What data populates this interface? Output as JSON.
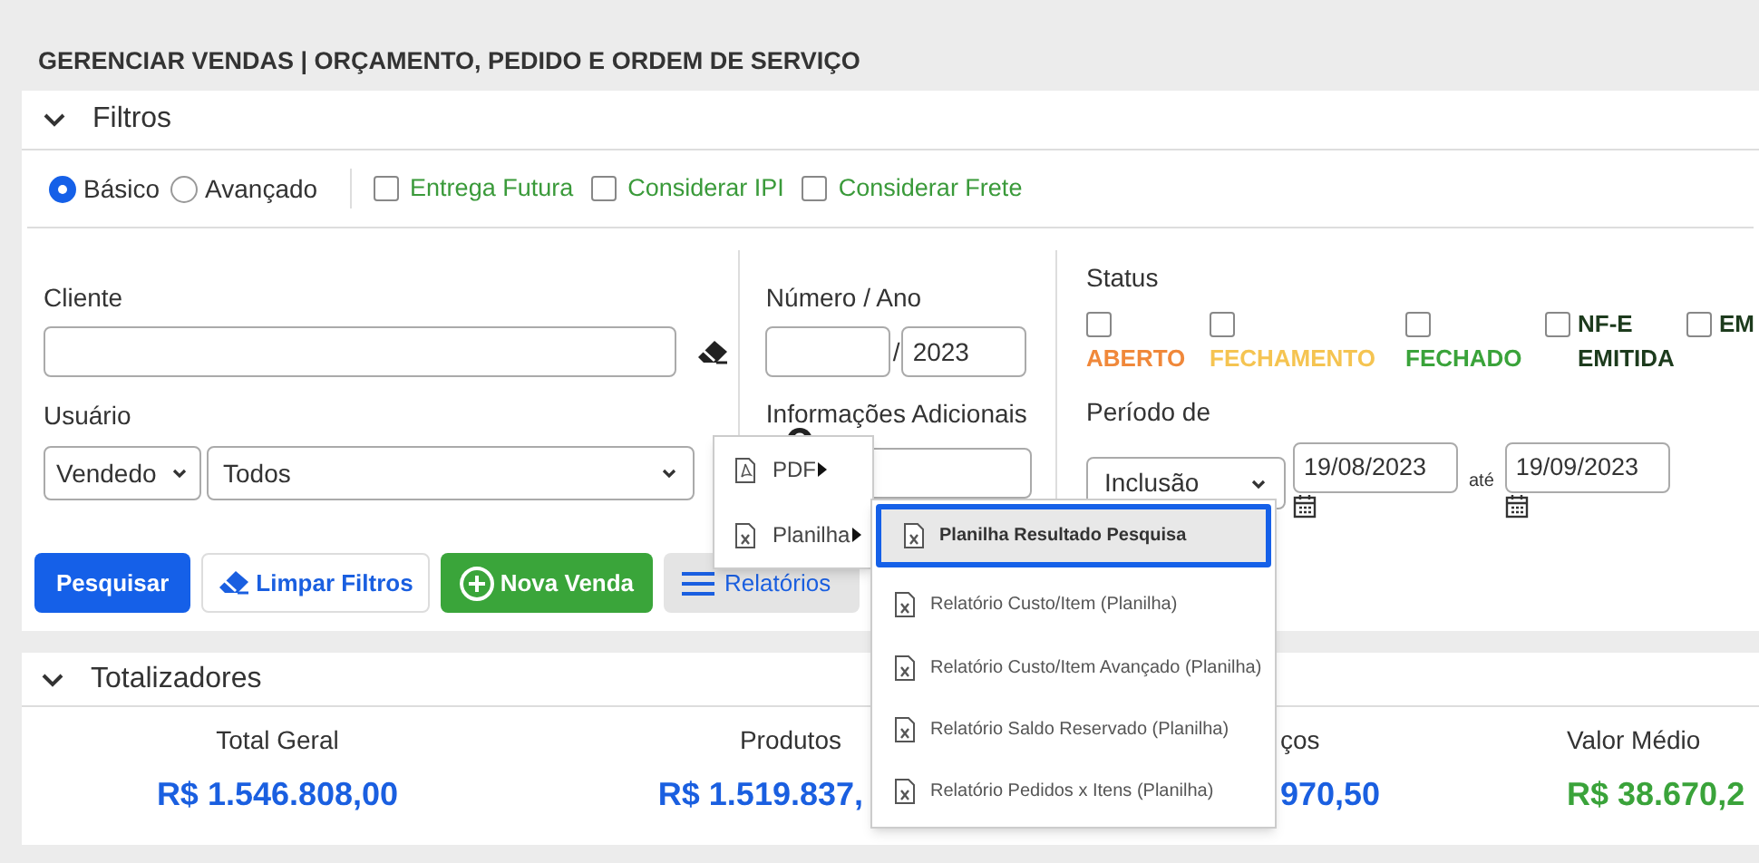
{
  "page_title": "GERENCIAR VENDAS | ORÇAMENTO, PEDIDO E ORDEM DE SERVIÇO",
  "filters": {
    "title": "Filtros",
    "expanded": true,
    "search_mode": [
      {
        "label": "Básico",
        "selected": true
      },
      {
        "label": "Avançado",
        "selected": false
      }
    ],
    "options": [
      {
        "label": "Entrega Futura",
        "checked": false
      },
      {
        "label": "Considerar IPI",
        "checked": false
      },
      {
        "label": "Considerar Frete",
        "checked": false
      }
    ],
    "cliente": {
      "label": "Cliente"
    },
    "usuario": {
      "label": "Usuário",
      "type_value": "Vendedo",
      "user_value": "Todos"
    },
    "numero_ano": {
      "label": "Número / Ano",
      "separator": "/",
      "year": "2023"
    },
    "info_adicionais": {
      "label": "Informações Adicionais"
    },
    "status": {
      "label": "Status",
      "items": [
        {
          "label": "ABERTO",
          "checked": false,
          "color": "#f0883a"
        },
        {
          "label": "FECHAMENTO",
          "checked": false,
          "color": "#f5c451"
        },
        {
          "label": "FECHADO",
          "checked": false,
          "color": "#3aa33a"
        },
        {
          "label": "NF-E EMITIDA",
          "checked": false,
          "color": "#1d3b1d"
        },
        {
          "label": "EM",
          "checked": false,
          "color": "#1d3b1d"
        }
      ]
    },
    "periodo": {
      "label": "Período de",
      "type_value": "Inclusão",
      "from": "19/08/2023",
      "to_label": "até",
      "to": "19/09/2023"
    }
  },
  "actions": [
    {
      "label": "Pesquisar",
      "kind": "primary"
    },
    {
      "label": "Limpar Filtros",
      "kind": "clear"
    },
    {
      "label": "Nova Venda",
      "kind": "new"
    },
    {
      "label": "Relatórios",
      "kind": "menu"
    }
  ],
  "reports_menu": {
    "items": [
      {
        "label": "PDF",
        "kind": "pdf"
      },
      {
        "label": "Planilha",
        "kind": "sheet"
      }
    ],
    "submenu": [
      {
        "label": "Planilha Resultado Pesquisa",
        "selected": true
      },
      {
        "label": "Relatório Custo/Item (Planilha)",
        "selected": false
      },
      {
        "label": "Relatório Custo/Item Avançado (Planilha)",
        "selected": false
      },
      {
        "label": "Relatório Saldo Reservado (Planilha)",
        "selected": false
      },
      {
        "label": "Relatório Pedidos x Itens (Planilha)",
        "selected": false
      }
    ]
  },
  "totalizers": {
    "title": "Totalizadores",
    "expanded": true,
    "items": [
      {
        "label": "Total Geral",
        "value": "R$ 1.546.808,00",
        "color": "#1a5fe0"
      },
      {
        "label": "Produtos",
        "value": "R$ 1.519.837,",
        "color": "#1a5fe0"
      },
      {
        "label": "ços",
        "value": "970,50",
        "color": "#1a5fe0"
      },
      {
        "label": "Valor Médio",
        "value": "R$ 38.670,2",
        "color": "#3aa33a"
      }
    ]
  }
}
